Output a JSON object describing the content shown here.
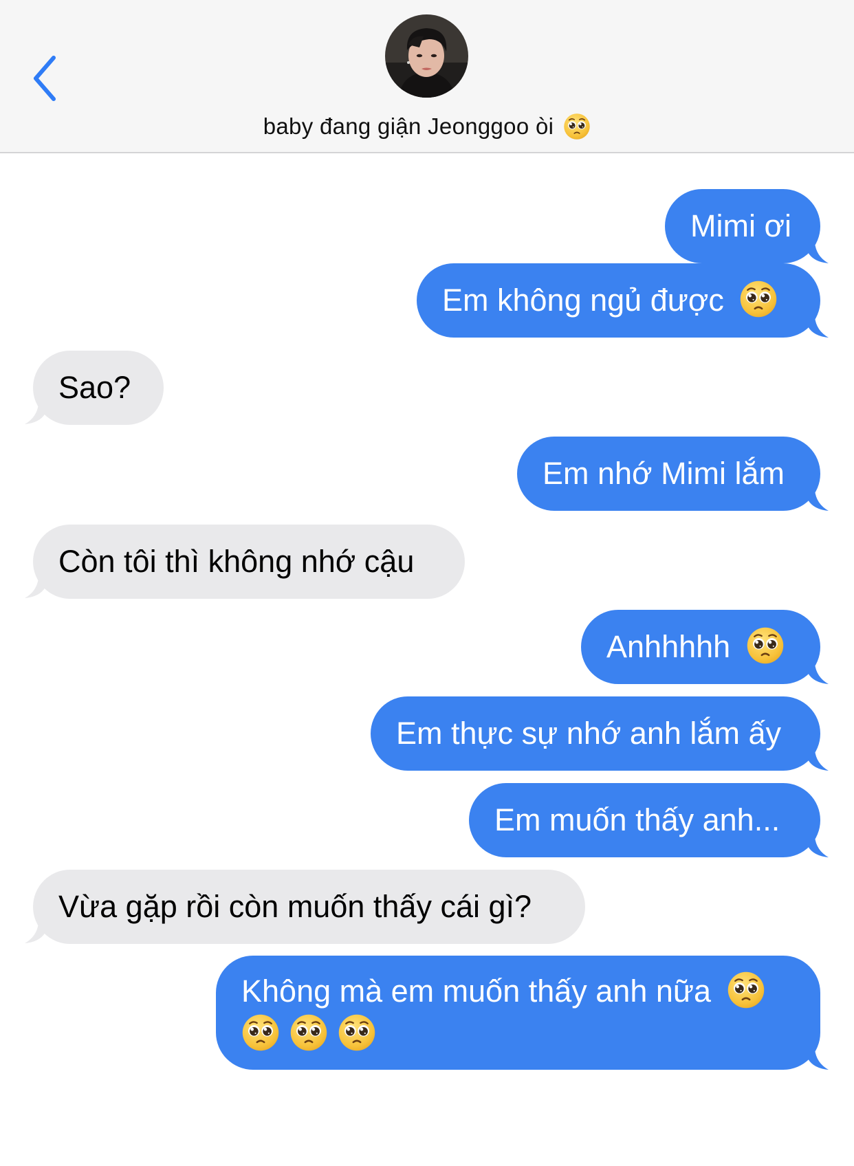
{
  "header": {
    "contact_name": "baby đang giận Jeonggoo òi",
    "contact_emoji": "pleading-face-emoji"
  },
  "messages": [
    {
      "id": "m1",
      "sender": "me",
      "text": "Mimi ơi"
    },
    {
      "id": "m2",
      "sender": "me",
      "text": "Em không ngủ được",
      "emoji": "pleading-face-emoji"
    },
    {
      "id": "m3",
      "sender": "them",
      "text": "Sao?"
    },
    {
      "id": "m4",
      "sender": "me",
      "text": "Em nhớ Mimi lắm"
    },
    {
      "id": "m5",
      "sender": "them",
      "text": "Còn tôi thì không nhớ cậu"
    },
    {
      "id": "m6",
      "sender": "me",
      "text": "Anhhhhh",
      "emoji": "pleading-face-emoji"
    },
    {
      "id": "m7",
      "sender": "me",
      "text": "Em thực sự nhớ anh lắm ấy"
    },
    {
      "id": "m8",
      "sender": "me",
      "text": "Em muốn thấy anh..."
    },
    {
      "id": "m9",
      "sender": "them",
      "text": "Vừa gặp rồi còn muốn thấy cái gì?"
    },
    {
      "id": "m10",
      "sender": "me",
      "text": "Không mà em muốn thấy anh nữa",
      "emoji_count": 4
    }
  ],
  "colors": {
    "outgoing_bubble": "#3b82f0",
    "incoming_bubble": "#e9e9eb",
    "accent": "#2f7cf6",
    "header_bg": "#f6f6f6"
  }
}
